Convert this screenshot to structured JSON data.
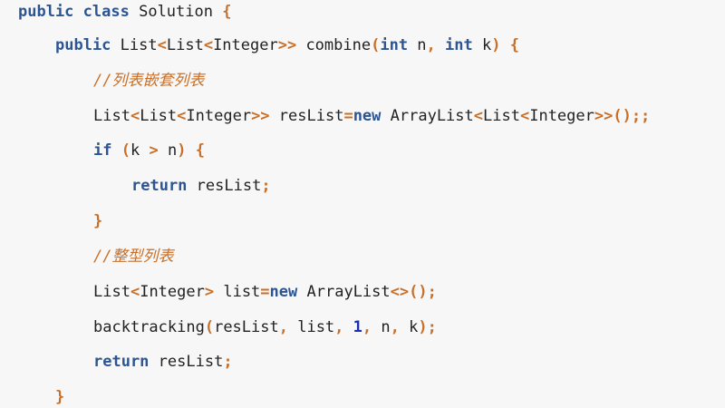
{
  "theme": {
    "background": "#f7f7f7",
    "keyword_color": "#2c5592",
    "punctuation_color": "#c8702a",
    "comment_color": "#c8702a",
    "number_color": "#1c2fb0",
    "text_color": "#222222"
  },
  "code": {
    "language": "java",
    "lines": [
      [
        {
          "t": "public",
          "k": "kw"
        },
        {
          "t": " ",
          "k": "tx"
        },
        {
          "t": "class",
          "k": "kw"
        },
        {
          "t": " Solution ",
          "k": "tx"
        },
        {
          "t": "{",
          "k": "pn"
        }
      ],
      [
        {
          "t": "public",
          "k": "kw"
        },
        {
          "t": " List",
          "k": "tx"
        },
        {
          "t": "<",
          "k": "pn"
        },
        {
          "t": "List",
          "k": "tx"
        },
        {
          "t": "<",
          "k": "pn"
        },
        {
          "t": "Integer",
          "k": "tx"
        },
        {
          "t": ">>",
          "k": "pn"
        },
        {
          "t": " combine",
          "k": "tx"
        },
        {
          "t": "(",
          "k": "pn"
        },
        {
          "t": "int",
          "k": "kw"
        },
        {
          "t": " n",
          "k": "tx"
        },
        {
          "t": ",",
          "k": "pn"
        },
        {
          "t": " ",
          "k": "tx"
        },
        {
          "t": "int",
          "k": "kw"
        },
        {
          "t": " k",
          "k": "tx"
        },
        {
          "t": ")",
          "k": "pn"
        },
        {
          "t": " ",
          "k": "tx"
        },
        {
          "t": "{",
          "k": "pn"
        }
      ],
      [
        {
          "t": "//列表嵌套列表",
          "k": "cm"
        }
      ],
      [
        {
          "t": "List",
          "k": "tx"
        },
        {
          "t": "<",
          "k": "pn"
        },
        {
          "t": "List",
          "k": "tx"
        },
        {
          "t": "<",
          "k": "pn"
        },
        {
          "t": "Integer",
          "k": "tx"
        },
        {
          "t": ">>",
          "k": "pn"
        },
        {
          "t": " resList",
          "k": "tx"
        },
        {
          "t": "=",
          "k": "pn"
        },
        {
          "t": "new",
          "k": "kw"
        },
        {
          "t": " ArrayList",
          "k": "tx"
        },
        {
          "t": "<",
          "k": "pn"
        },
        {
          "t": "List",
          "k": "tx"
        },
        {
          "t": "<",
          "k": "pn"
        },
        {
          "t": "Integer",
          "k": "tx"
        },
        {
          "t": ">>();;",
          "k": "pn"
        }
      ],
      [
        {
          "t": "if",
          "k": "kw"
        },
        {
          "t": " ",
          "k": "tx"
        },
        {
          "t": "(",
          "k": "pn"
        },
        {
          "t": "k ",
          "k": "tx"
        },
        {
          "t": ">",
          "k": "pn"
        },
        {
          "t": " n",
          "k": "tx"
        },
        {
          "t": ")",
          "k": "pn"
        },
        {
          "t": " ",
          "k": "tx"
        },
        {
          "t": "{",
          "k": "pn"
        }
      ],
      [
        {
          "t": "return",
          "k": "kw"
        },
        {
          "t": " resList",
          "k": "tx"
        },
        {
          "t": ";",
          "k": "pn"
        }
      ],
      [
        {
          "t": "}",
          "k": "pn"
        }
      ],
      [
        {
          "t": "//整型列表",
          "k": "cm"
        }
      ],
      [
        {
          "t": "List",
          "k": "tx"
        },
        {
          "t": "<",
          "k": "pn"
        },
        {
          "t": "Integer",
          "k": "tx"
        },
        {
          "t": ">",
          "k": "pn"
        },
        {
          "t": " list",
          "k": "tx"
        },
        {
          "t": "=",
          "k": "pn"
        },
        {
          "t": "new",
          "k": "kw"
        },
        {
          "t": " ArrayList",
          "k": "tx"
        },
        {
          "t": "<>();",
          "k": "pn"
        }
      ],
      [
        {
          "t": "backtracking",
          "k": "tx"
        },
        {
          "t": "(",
          "k": "pn"
        },
        {
          "t": "resList",
          "k": "tx"
        },
        {
          "t": ",",
          "k": "pn"
        },
        {
          "t": " list",
          "k": "tx"
        },
        {
          "t": ",",
          "k": "pn"
        },
        {
          "t": " ",
          "k": "tx"
        },
        {
          "t": "1",
          "k": "num"
        },
        {
          "t": ",",
          "k": "pn"
        },
        {
          "t": " n",
          "k": "tx"
        },
        {
          "t": ",",
          "k": "pn"
        },
        {
          "t": " k",
          "k": "tx"
        },
        {
          "t": ");",
          "k": "pn"
        }
      ],
      [
        {
          "t": "return",
          "k": "kw"
        },
        {
          "t": " resList",
          "k": "tx"
        },
        {
          "t": ";",
          "k": "pn"
        }
      ],
      [
        {
          "t": "}",
          "k": "pn"
        }
      ]
    ]
  }
}
